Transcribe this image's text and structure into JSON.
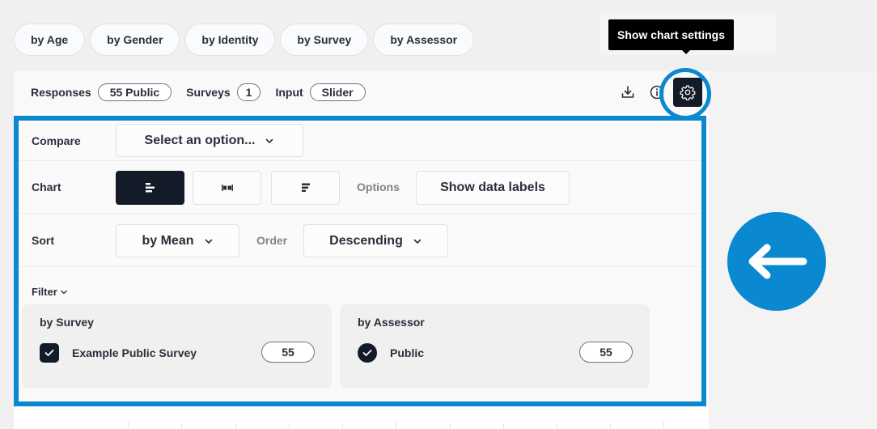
{
  "tabs": [
    "by Age",
    "by Gender",
    "by Identity",
    "by Survey",
    "by Assessor"
  ],
  "tooltip": "Show chart settings",
  "summary": {
    "responses_label": "Responses",
    "responses_value": "55 Public",
    "surveys_label": "Surveys",
    "surveys_value": "1",
    "input_label": "Input",
    "input_value": "Slider"
  },
  "icons": {
    "download": "download-icon",
    "info": "info-icon",
    "settings": "gear-icon",
    "back": "arrow-left-icon"
  },
  "settings": {
    "compare_label": "Compare",
    "compare_value": "Select an option...",
    "chart_label": "Chart",
    "chart_types": [
      "bar-chart",
      "range-chart",
      "stacked-chart"
    ],
    "chart_active": "bar-chart",
    "options_label": "Options",
    "show_data_labels": "Show data labels",
    "sort_label": "Sort",
    "sort_value": "by Mean",
    "order_label": "Order",
    "order_value": "Descending",
    "filter_label": "Filter"
  },
  "filters": [
    {
      "title": "by Survey",
      "items": [
        {
          "label": "Example Public Survey",
          "count": "55",
          "checked": true
        }
      ]
    },
    {
      "title": "by Assessor",
      "items": [
        {
          "label": "Public",
          "count": "55",
          "checked": true
        }
      ]
    }
  ],
  "colors": {
    "accent": "#0a88d0",
    "dark": "#131a28"
  }
}
